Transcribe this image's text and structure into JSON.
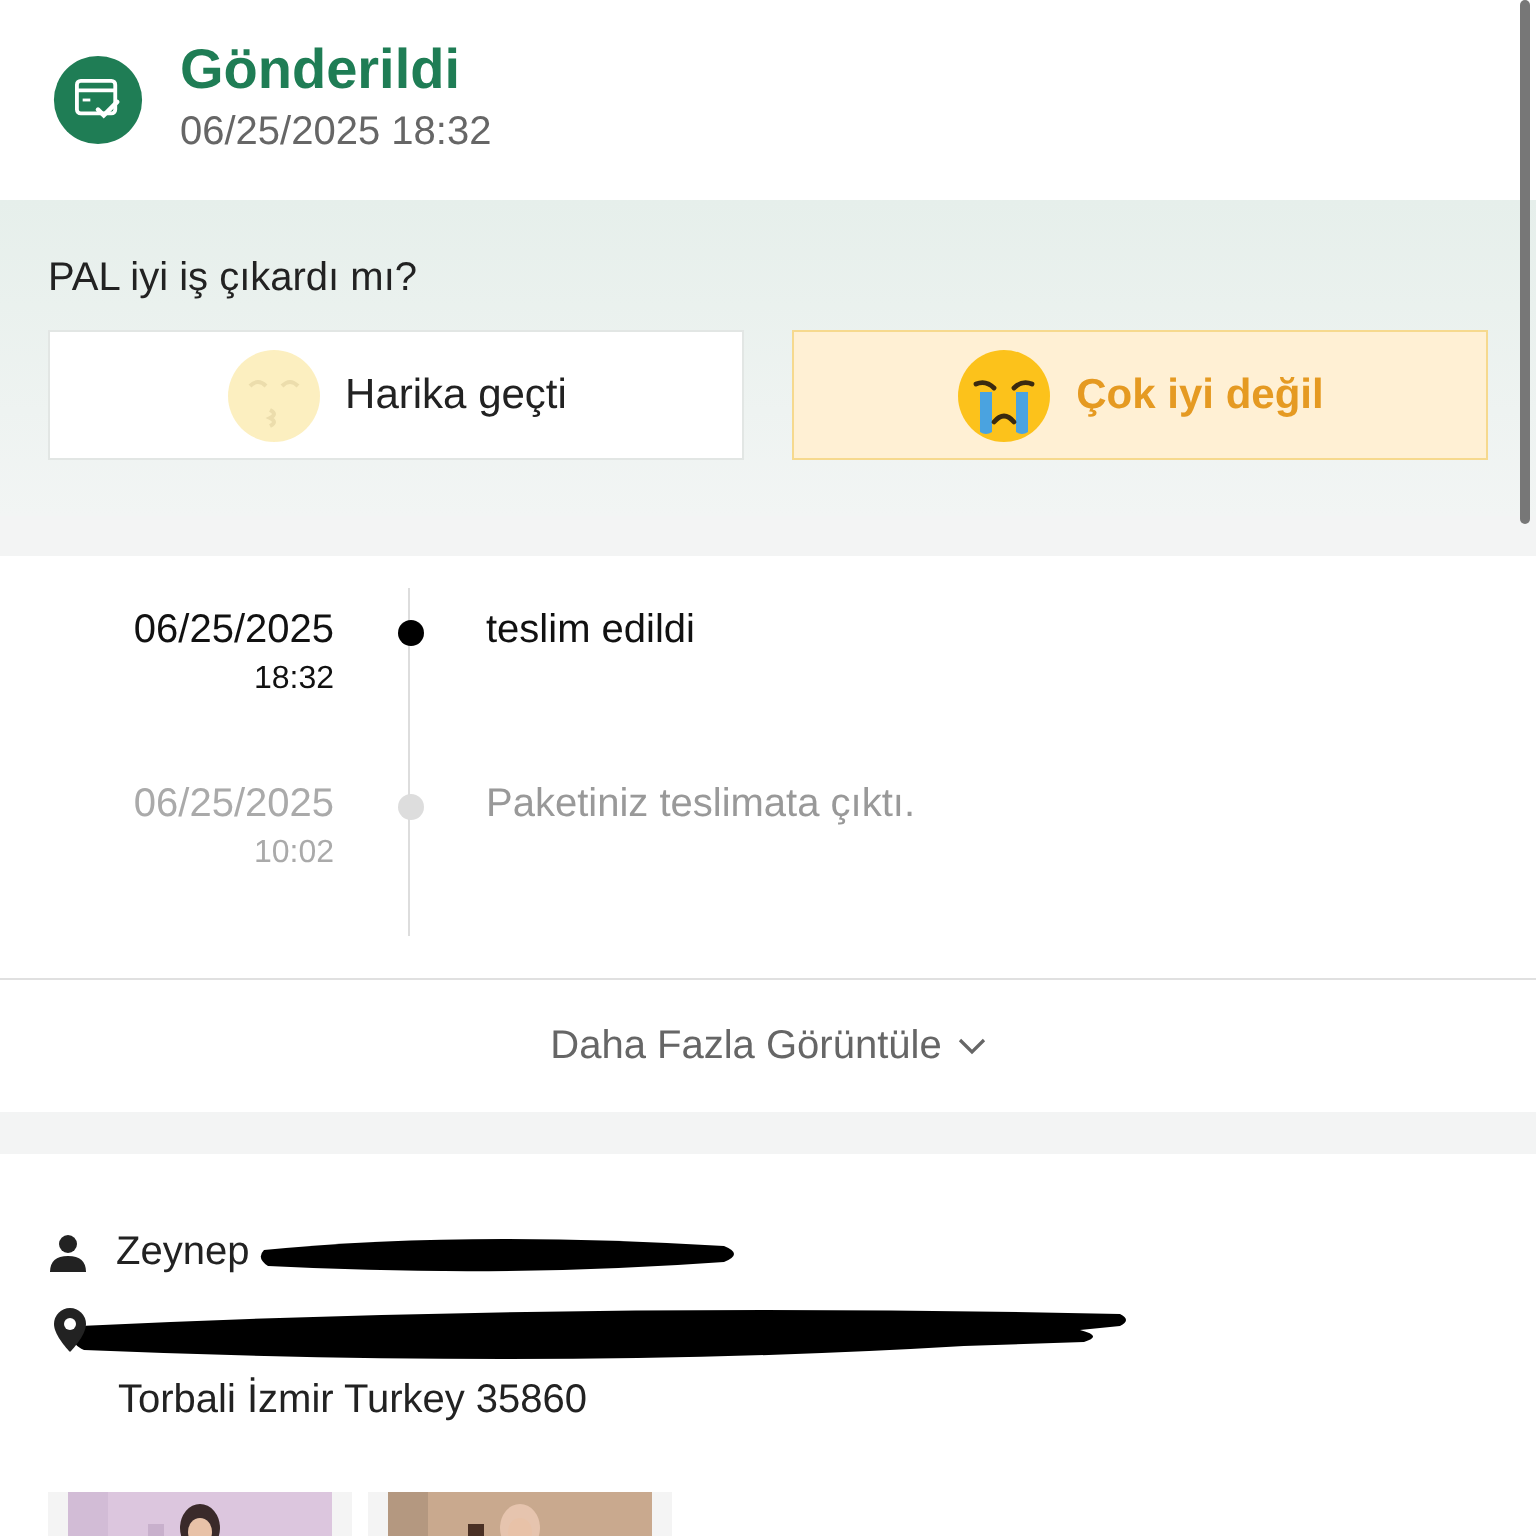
{
  "status": {
    "title": "Gönderildi",
    "datetime": "06/25/2025 18:32"
  },
  "rating": {
    "question": "PAL iyi iş çıkardı mı?",
    "options": [
      {
        "kind": "happy",
        "label": "Harika geçti",
        "selected": false
      },
      {
        "kind": "crying",
        "label": "Çok iyi değil",
        "selected": true
      }
    ]
  },
  "timeline": [
    {
      "date": "06/25/2025",
      "time": "18:32",
      "text": "teslim edildi",
      "current": true
    },
    {
      "date": "06/25/2025",
      "time": "10:02",
      "text": "Paketiniz teslimata çıktı.",
      "current": false
    }
  ],
  "more_button": "Daha Fazla Görüntüle",
  "address": {
    "name": "Zeynep",
    "line_2": "Torbali İzmir Turkey 35860"
  }
}
